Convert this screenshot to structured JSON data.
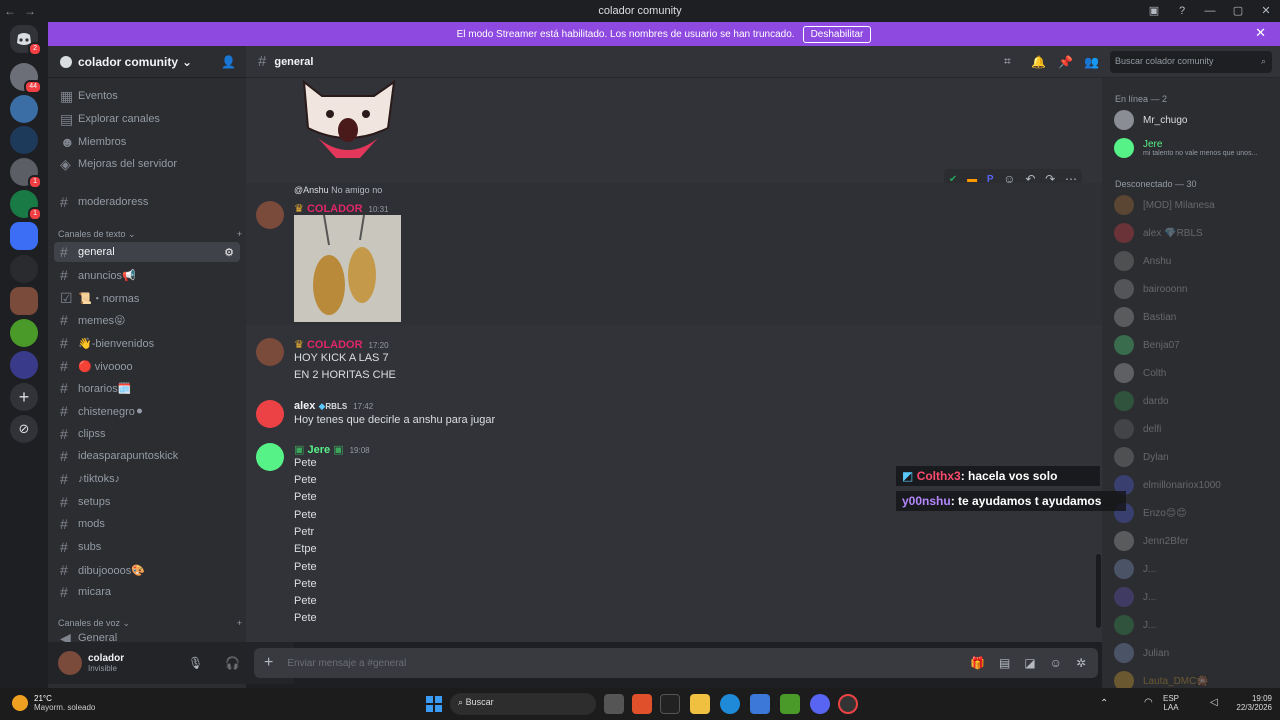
{
  "window": {
    "title": "colador comunity"
  },
  "banner": {
    "text": "El modo Streamer está habilitado. Los nombres de usuario se han truncado.",
    "button": "Deshabilitar"
  },
  "rail": {
    "badges": [
      "2",
      "44",
      "1",
      "1",
      "1"
    ]
  },
  "server": {
    "name": "colador comunity"
  },
  "sidebar": {
    "top_items": [
      "Eventos",
      "Explorar canales",
      "Miembros",
      "Mejoras del servidor"
    ],
    "pinned_channel": "moderadoress",
    "text_category": "Canales de texto",
    "channels": [
      "general",
      "anuncios📢",
      "📜・normas",
      "memes😝",
      "👋-bienvenidos",
      "🔴 vivoooo",
      "horarios🗓️",
      "chistenegro⚫",
      "clipss",
      "ideasparapuntoskick",
      "♪tiktoks♪",
      "setups",
      "mods",
      "subs",
      "dibujooоos🎨",
      "micara"
    ],
    "voice_category": "Canales de voz",
    "voice_channels": [
      "General"
    ]
  },
  "user": {
    "name": "colador",
    "status": "Invisible"
  },
  "chat": {
    "channel": "general",
    "search_placeholder": "Buscar colador comunity",
    "reply": {
      "name": "@Anshu",
      "text": "No amigo no"
    },
    "messages": [
      {
        "author": "COLADOR",
        "time": "10:31",
        "color": "#e0266b",
        "lines": []
      },
      {
        "author": "COLADOR",
        "time": "17:20",
        "color": "#e0266b",
        "lines": [
          "HOY KICK A LAS 7",
          "EN 2 HORITAS CHE"
        ]
      },
      {
        "author": "alex",
        "tag": "RBLS",
        "time": "17:42",
        "color": "#f2f3f5",
        "lines": [
          "Hoy tenes que decirle a anshu para jugar"
        ]
      },
      {
        "author": "Jere",
        "time": "19:08",
        "color": "#57f287",
        "lines": [
          "Pete",
          "Pete",
          "Pete",
          "Pete",
          "Petr",
          "Etpe",
          "Pete",
          "Pete",
          "Pete",
          "Pete"
        ]
      }
    ],
    "composer_placeholder": "Enviar mensaje a #general"
  },
  "overlay": [
    {
      "user": "Colthx3",
      "color": "#ff4a6e",
      "text": ": hacela vos solo"
    },
    {
      "user": "y00nshu",
      "color": "#b388ff",
      "text": ": te ayudamos t ayudamos"
    }
  ],
  "members": {
    "online_header": "En línea — 2",
    "online": [
      {
        "name": "Mr_chugo",
        "sub": ""
      },
      {
        "name": "Jere",
        "sub": "mi talento no vale menos que unos..."
      }
    ],
    "offline_header": "Desconectado — 30",
    "offline": [
      "[MOD] Milanesa",
      "alex 💎RBLS",
      "Anshu",
      "bairooonn",
      "Bastian",
      "Benja07",
      "Colth",
      "dardo",
      "delfi",
      "Dylan",
      "elmillonariox1000",
      "Enzo😊😊",
      "Jenn2Bfer",
      "J...",
      "J...",
      "J...",
      "Julian",
      "Lauta_DMC🎇"
    ]
  },
  "taskbar": {
    "weather_temp": "21°C",
    "weather_desc": "Mayorm. soleado",
    "search": "Buscar",
    "lang": "ESP",
    "lang2": "LAA",
    "time": "19:09",
    "date": "22/3/2026"
  }
}
